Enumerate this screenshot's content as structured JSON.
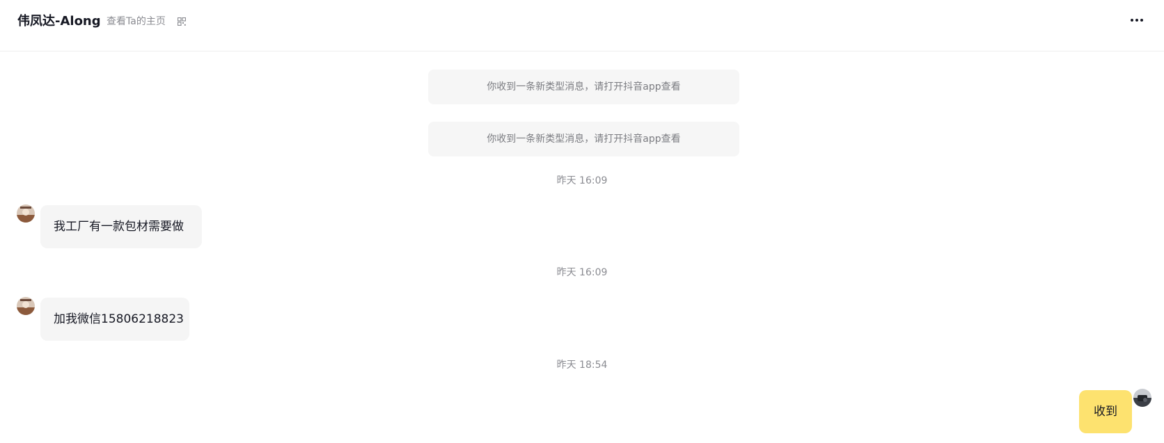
{
  "header": {
    "contact_name": "伟凤达-Along",
    "profile_link": "查看Ta的主页",
    "qr_icon": "qr-code-icon",
    "more_icon": "more-horizontal-icon"
  },
  "notices": [
    {
      "text": "你收到一条新类型消息，请打开抖音app查看"
    },
    {
      "text": "你收到一条新类型消息，请打开抖音app查看"
    }
  ],
  "messages": [
    {
      "timestamp": "昨天 16:09",
      "sender": "contact",
      "text": "我工厂有一款包材需要做"
    },
    {
      "timestamp": "昨天 16:09",
      "sender": "contact",
      "text": "加我微信15806218823"
    },
    {
      "timestamp": "昨天 18:54",
      "sender": "me",
      "text": "收到"
    }
  ],
  "colors": {
    "outgoing_bubble": "#fde26f",
    "incoming_bubble": "#f5f5f5",
    "notice_bg": "#f6f6f6",
    "muted_text": "#8a8b91"
  }
}
